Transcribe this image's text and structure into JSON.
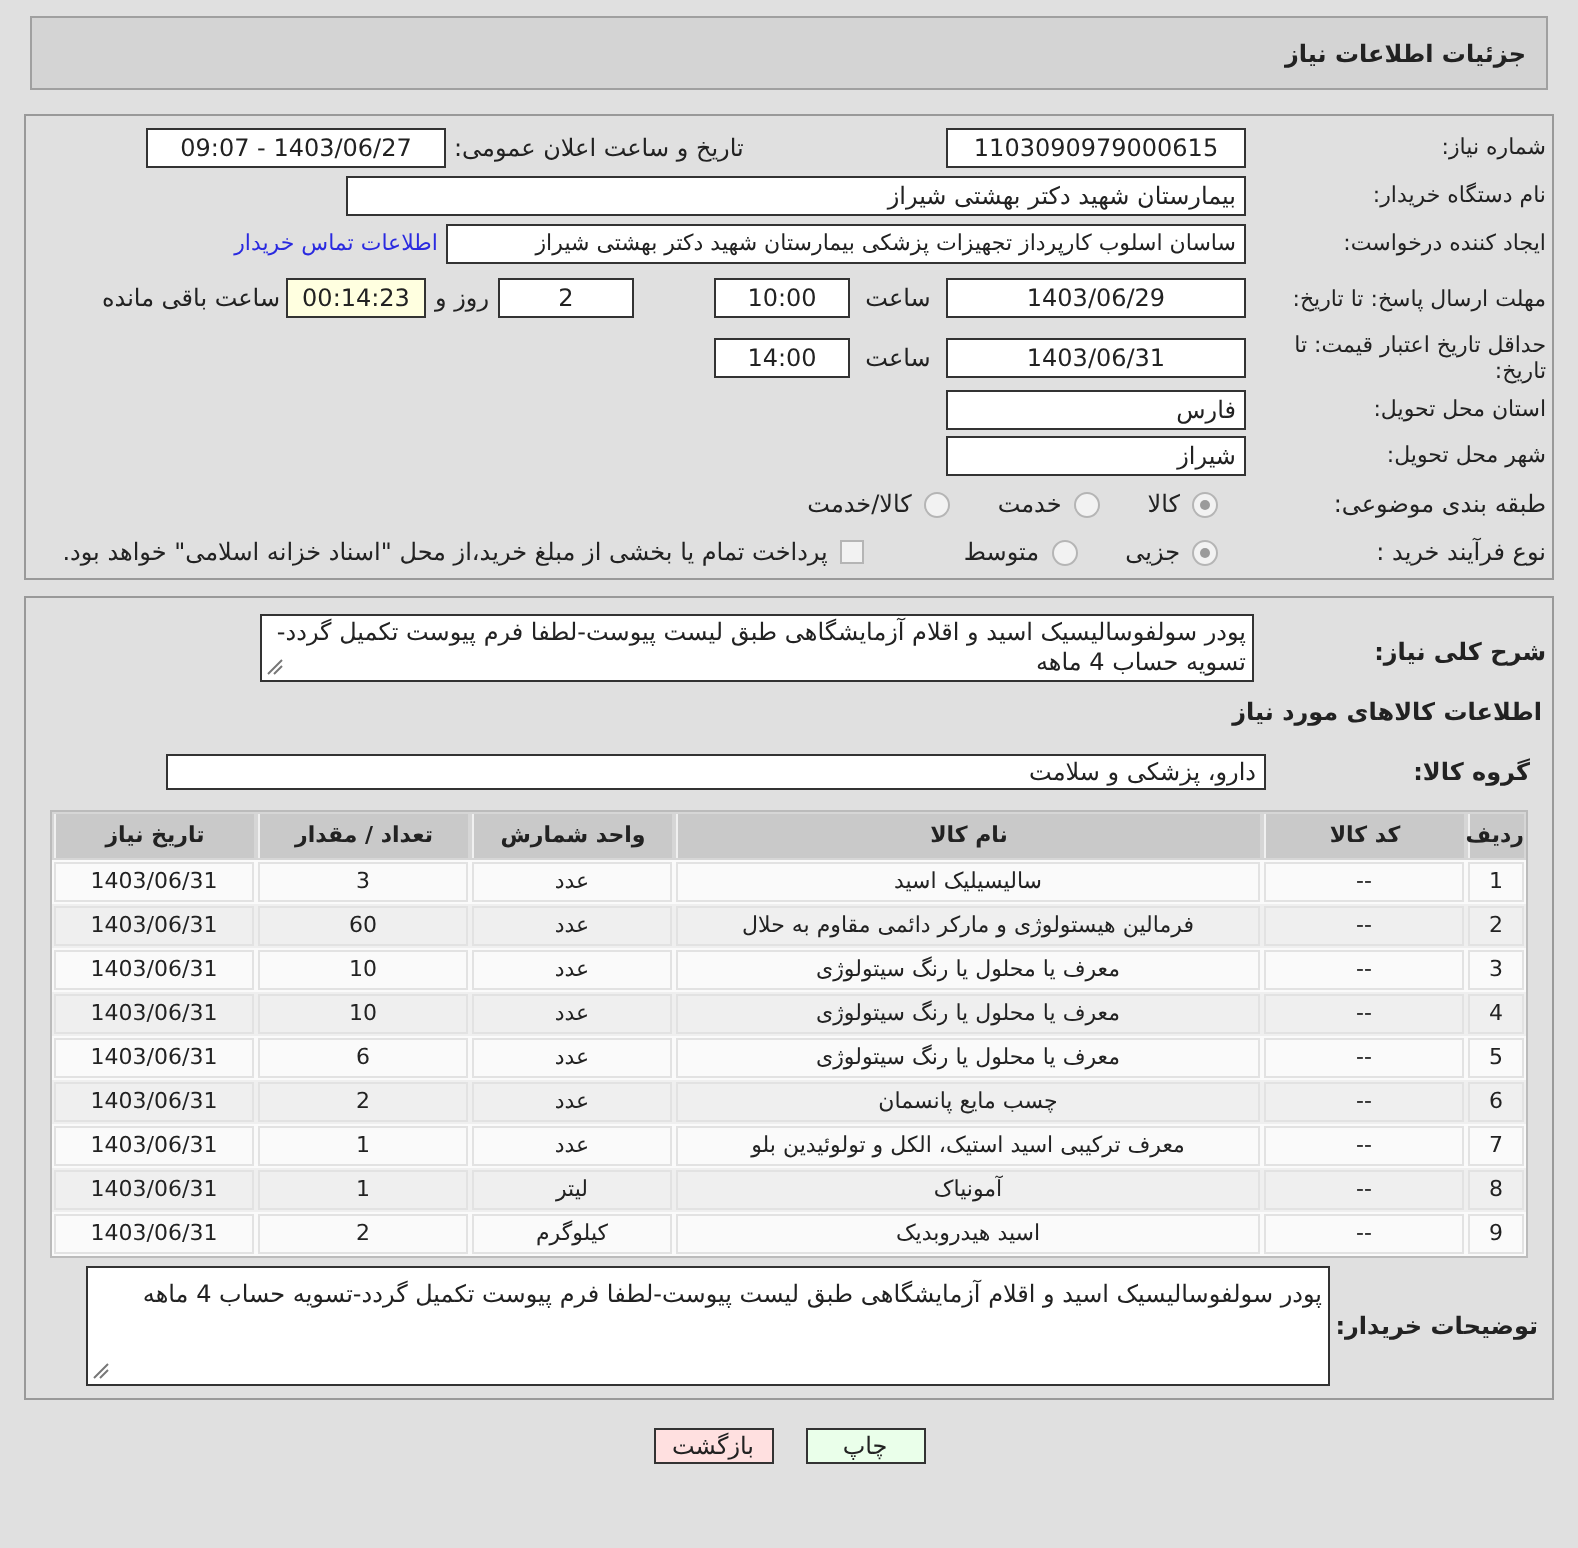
{
  "title": "جزئیات اطلاعات نیاز",
  "need_number": {
    "label": "شماره نیاز:",
    "value": "1103090979000615"
  },
  "announce": {
    "label": "تاریخ و ساعت اعلان عمومی:",
    "value": "1403/06/27 - 09:07"
  },
  "buyer_org": {
    "label": "نام دستگاه خریدار:",
    "value": "بیمارستان شهید دکتر بهشتی شیراز"
  },
  "creator": {
    "label": "ایجاد کننده درخواست:",
    "value": "ساسان اسلوب کارپرداز  تجهیزات پزشکی بیمارستان شهید دکتر بهشتی شیراز",
    "link": "اطلاعات تماس خریدار"
  },
  "deadline": {
    "label": "مهلت ارسال پاسخ: تا تاریخ:",
    "date": "1403/06/29",
    "time_label": "ساعت",
    "time": "10:00",
    "days": "2",
    "days_label": "روز و",
    "remaining": "00:14:23",
    "remaining_label": "ساعت باقی مانده"
  },
  "validity": {
    "label": "حداقل تاریخ اعتبار قیمت: تا تاریخ:",
    "date": "1403/06/31",
    "time_label": "ساعت",
    "time": "14:00"
  },
  "province": {
    "label": "استان محل تحویل:",
    "value": "فارس"
  },
  "city": {
    "label": "شهر محل تحویل:",
    "value": "شیراز"
  },
  "category": {
    "label": "طبقه بندی موضوعی:",
    "options": [
      {
        "label": "کالا",
        "selected": true
      },
      {
        "label": "خدمت",
        "selected": false
      },
      {
        "label": "کالا/خدمت",
        "selected": false
      }
    ]
  },
  "process": {
    "label": "نوع فرآیند خرید :",
    "options": [
      {
        "label": "جزیی",
        "selected": true
      },
      {
        "label": "متوسط",
        "selected": false
      }
    ],
    "payment": {
      "checked": false,
      "label": "پرداخت تمام یا بخشی از مبلغ خرید،از محل \"اسناد خزانه اسلامی\" خواهد بود."
    }
  },
  "description": {
    "label": "شرح کلی نیاز:",
    "value": "پودر سولفوسالیسیک اسید و اقلام آزمایشگاهی طبق لیست پیوست-لطفا فرم پیوست تکمیل گردد-تسویه حساب 4 ماهه"
  },
  "goods_heading": "اطلاعات کالاهای مورد نیاز",
  "goods_group": {
    "label": "گروه کالا:",
    "value": "دارو، پزشکی و سلامت"
  },
  "table": {
    "columns": [
      "ردیف",
      "کد کالا",
      "نام کالا",
      "واحد شمارش",
      "تعداد / مقدار",
      "تاریخ نیاز"
    ],
    "rows": [
      [
        "1",
        "--",
        "سالیسیلیک اسید",
        "عدد",
        "3",
        "1403/06/31"
      ],
      [
        "2",
        "--",
        "فرمالین هیستولوژی و مارکر دائمی مقاوم به حلال",
        "عدد",
        "60",
        "1403/06/31"
      ],
      [
        "3",
        "--",
        "معرف یا محلول یا رنگ سیتولوژی",
        "عدد",
        "10",
        "1403/06/31"
      ],
      [
        "4",
        "--",
        "معرف یا محلول یا رنگ سیتولوژی",
        "عدد",
        "10",
        "1403/06/31"
      ],
      [
        "5",
        "--",
        "معرف یا محلول یا رنگ سیتولوژی",
        "عدد",
        "6",
        "1403/06/31"
      ],
      [
        "6",
        "--",
        "چسب مایع پانسمان",
        "عدد",
        "2",
        "1403/06/31"
      ],
      [
        "7",
        "--",
        "معرف ترکیبی اسید استیک، الکل و تولوئیدین بلو",
        "عدد",
        "1",
        "1403/06/31"
      ],
      [
        "8",
        "--",
        "آمونیاک",
        "لیتر",
        "1",
        "1403/06/31"
      ],
      [
        "9",
        "--",
        "اسید هیدروبدیک",
        "کیلوگرم",
        "2",
        "1403/06/31"
      ]
    ]
  },
  "buyer_notes": {
    "label": "توضیحات خریدار:",
    "value": "پودر سولفوسالیسیک اسید و اقلام آزمایشگاهی طبق لیست پیوست-لطفا فرم پیوست تکمیل گردد-تسویه حساب 4 ماهه"
  },
  "buttons": [
    {
      "label": "چاپ",
      "kind": "print"
    },
    {
      "label": "بازگشت",
      "kind": "back"
    }
  ]
}
